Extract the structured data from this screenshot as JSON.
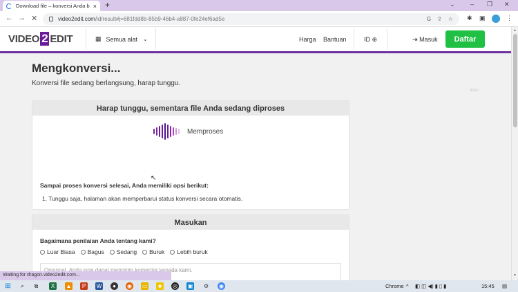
{
  "browser": {
    "tab_title": "Download file – konversi Anda b",
    "new_tab": "+",
    "close_tab": "×",
    "url_host": "video2edit.com",
    "url_path": "/id/result#j=681fdd8b-85b9-46b4-a887-0fe24ef6ad5e",
    "status_text": "Waiting for dragon.video2edit.com..."
  },
  "header": {
    "logo_left": "VIDEO",
    "logo_mid": "2",
    "logo_right": "EDIT",
    "tools_label": "Semua alat",
    "nav_price": "Harga",
    "nav_help": "Bantuan",
    "lang": "ID",
    "login": "Masuk",
    "signup": "Daftar"
  },
  "page": {
    "title": "Mengkonversi...",
    "subtitle": "Konversi file sedang berlangsung, harap tunggu.",
    "ad_label": "Iklan"
  },
  "processing_card": {
    "heading": "Harap tunggu, sementara file Anda sedang diproses",
    "status": "Memproses",
    "options_title": "Sampai proses konversi selesai, Anda memiliki opsi berikut:",
    "option_1": "1. Tunggu saja, halaman akan memperbarui status konversi secara otomatis."
  },
  "feedback_card": {
    "heading": "Masukan",
    "question": "Bagaimana penilaian Anda tentang kami?",
    "ratings": [
      "Luar Biasa",
      "Bagus",
      "Sedang",
      "Buruk",
      "Lebih buruk"
    ],
    "comment_placeholder": "Opsional. Anda juga dapat mengirim komentar kepada kami."
  },
  "taskbar": {
    "app": "Chrome",
    "time": "15:45"
  },
  "colors": {
    "brand_purple": "#6f2ea1",
    "signup_green": "#20c045"
  }
}
